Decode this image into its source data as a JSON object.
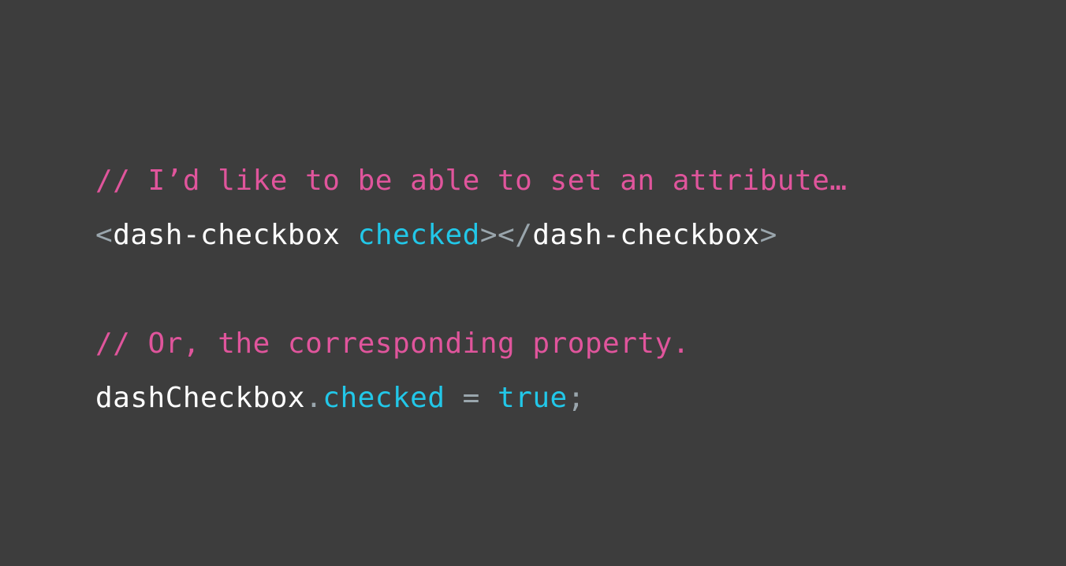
{
  "colors": {
    "background": "#3d3d3d",
    "comment": "#e0559c",
    "punctuation": "#9aa6ad",
    "text": "#ffffff",
    "keyword": "#22c7e8"
  },
  "code": {
    "comment1": "// I’d like to be able to set an attribute…",
    "line2": {
      "open_lt": "<",
      "tag_open": "dash-checkbox",
      "space": " ",
      "attribute": "checked",
      "gt_lt_slash": "></",
      "tag_close": "dash-checkbox",
      "close_gt": ">"
    },
    "comment2": "// Or, the corresponding property.",
    "line4": {
      "object": "dashCheckbox",
      "dot": ".",
      "property": "checked",
      "equals": " = ",
      "value": "true",
      "semicolon": ";"
    }
  }
}
